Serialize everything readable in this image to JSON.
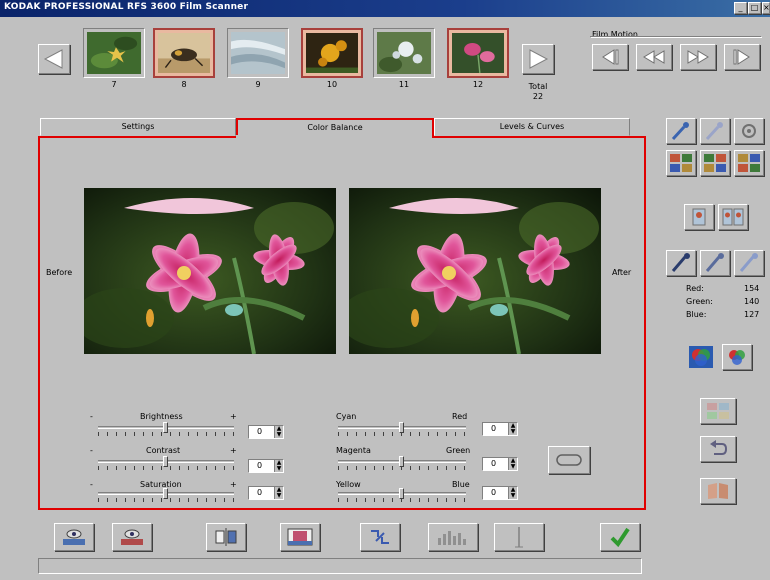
{
  "window": {
    "title": "KODAK PROFESSIONAL RFS 3600 Film Scanner",
    "controls": [
      "_",
      "□",
      "×"
    ]
  },
  "filmstrip": {
    "frames": [
      {
        "number": "7",
        "selected": false
      },
      {
        "number": "8",
        "selected": true
      },
      {
        "number": "9",
        "selected": false
      },
      {
        "number": "10",
        "selected": true
      },
      {
        "number": "11",
        "selected": false
      },
      {
        "number": "12",
        "selected": true
      }
    ],
    "total_label": "Total",
    "total_value": "22",
    "film_motion_label": "Film Motion"
  },
  "tabs": [
    {
      "label": "Settings",
      "active": false
    },
    {
      "label": "Color Balance",
      "active": true
    },
    {
      "label": "Levels & Curves",
      "active": false
    }
  ],
  "preview": {
    "before_label": "Before",
    "after_label": "After"
  },
  "sliders_left": [
    {
      "label": "Brightness",
      "minus": "-",
      "plus": "+",
      "value": "0",
      "position": 0.5
    },
    {
      "label": "Contrast",
      "minus": "-",
      "plus": "+",
      "value": "0",
      "position": 0.5
    },
    {
      "label": "Saturation",
      "minus": "-",
      "plus": "+",
      "value": "0",
      "position": 0.5
    }
  ],
  "sliders_right": [
    {
      "left_label": "Cyan",
      "right_label": "Red",
      "value": "0",
      "position": 0.5
    },
    {
      "left_label": "Magenta",
      "right_label": "Green",
      "value": "0",
      "position": 0.5
    },
    {
      "left_label": "Yellow",
      "right_label": "Blue",
      "value": "0",
      "position": 0.5
    }
  ],
  "rgb_readout": {
    "red_label": "Red:",
    "red_value": "154",
    "green_label": "Green:",
    "green_value": "140",
    "blue_label": "Blue:",
    "blue_value": "127"
  },
  "colors": {
    "highlight_border": "#e00000",
    "title_bar": "#0a246a",
    "ok_check": "#2f9a2f"
  }
}
